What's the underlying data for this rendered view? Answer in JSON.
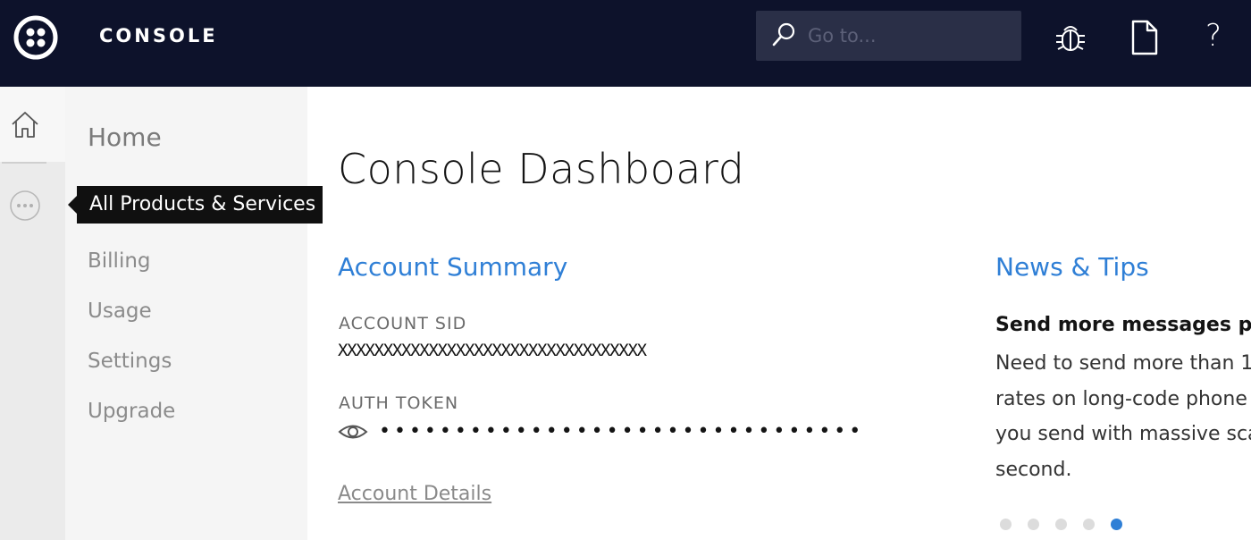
{
  "topbar": {
    "brand": "CONSOLE",
    "search_placeholder": "Go to...",
    "icons": [
      "twilio-logo-icon",
      "search-icon",
      "bug-icon",
      "document-icon",
      "help-icon"
    ]
  },
  "rail": {
    "icons": [
      "home-icon",
      "more-icon"
    ]
  },
  "subnav": {
    "home": "Home",
    "billing": "Billing",
    "usage": "Usage",
    "settings": "Settings",
    "upgrade": "Upgrade"
  },
  "tooltip": "All Products & Services",
  "main": {
    "title": "Console Dashboard",
    "account_summary": {
      "heading": "Account Summary",
      "sid_label": "ACCOUNT SID",
      "sid_value": "XXXXXXXXXXXXXXXXXXXXXXXXXXXXXXXXXX",
      "token_label": "AUTH TOKEN",
      "token_value": "••••••••••••••••••••••••••••••••",
      "details_link": "Account Details"
    },
    "news": {
      "heading": "News & Tips",
      "item_title": "Send more messages per",
      "item_lines": [
        "Need to send more than 1",
        "rates on long-code phone",
        "you send with massive sca",
        "second."
      ],
      "dots_total": 5,
      "active_dot": 5
    }
  },
  "colors": {
    "topbar": "#0d122b",
    "accent": "#2f7fd6",
    "active_dot": "#2f7fd6"
  }
}
